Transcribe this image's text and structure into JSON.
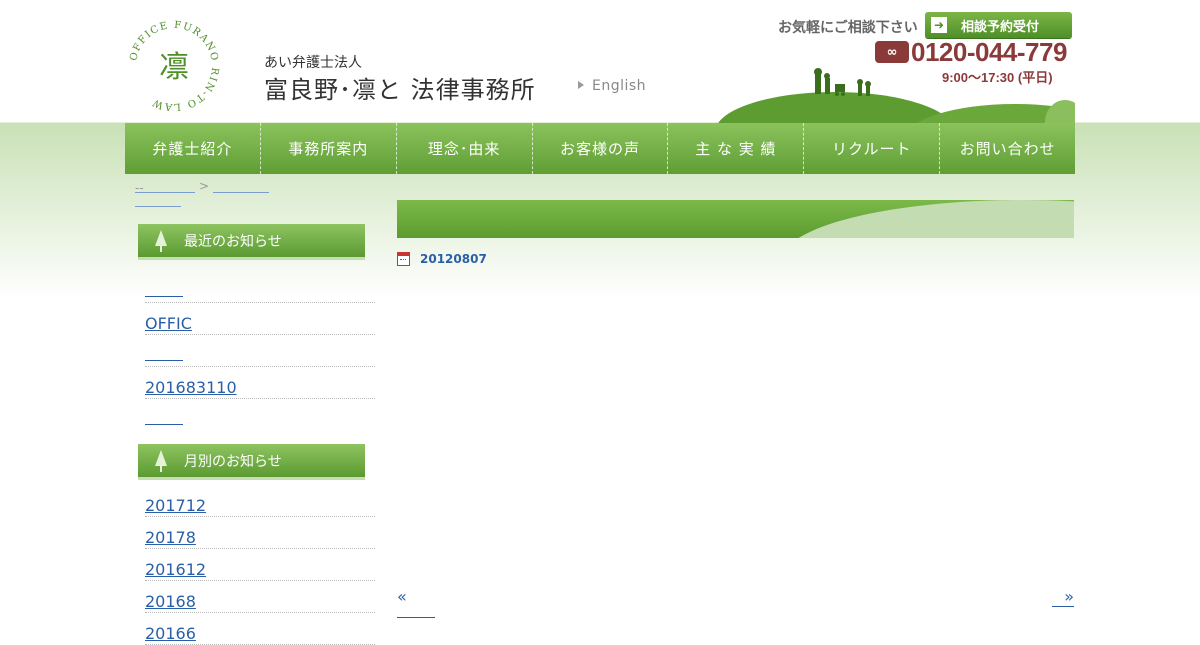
{
  "header": {
    "seal_text": "OFFICE FURANO RIN-TO LAW",
    "seal_char": "凛",
    "org_sub": "あい弁護士法人",
    "org_name": "富良野･凛と 法律事務所",
    "english_link": "English",
    "consult_text": "お気軽にご相談下さい",
    "consult_button": "相談予約受付",
    "phone_number": "0120-044-779",
    "hours": "9:00～17:30 (平日)",
    "brand_color": "#5f9e34",
    "phone_color": "#8b3a3a"
  },
  "nav": {
    "items": [
      {
        "label": "弁護士紹介"
      },
      {
        "label": "事務所案内"
      },
      {
        "label": "理念･由来"
      },
      {
        "label": "お客様の声"
      },
      {
        "label": "主 な 実 績"
      },
      {
        "label": "リクルート"
      },
      {
        "label": "お問い合わせ"
      }
    ]
  },
  "breadcrumb": {
    "home": "--",
    "separator": ">"
  },
  "sidebar": {
    "recent_heading": "最近のお知らせ",
    "recent_items": [
      {
        "label": ""
      },
      {
        "label": "OFFIC"
      },
      {
        "label": ""
      },
      {
        "label": "201683110"
      },
      {
        "label": ""
      }
    ],
    "monthly_heading": "月別のお知らせ",
    "monthly_items": [
      {
        "label": "201712"
      },
      {
        "label": "20178"
      },
      {
        "label": "201612"
      },
      {
        "label": "20168"
      },
      {
        "label": "20166"
      }
    ]
  },
  "main": {
    "post_date": "20120807",
    "prev_link": "«",
    "next_link": "»"
  }
}
